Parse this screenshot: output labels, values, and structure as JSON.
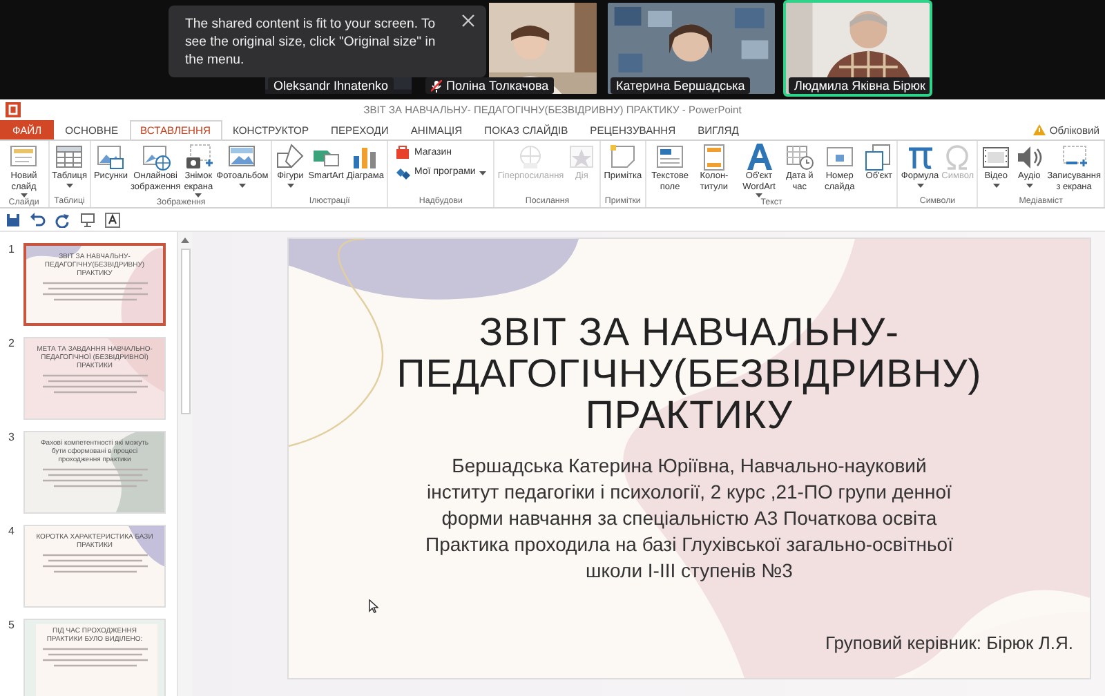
{
  "call": {
    "toast": {
      "text": "The shared content is fit to your screen. To see the original size, click \"Original size\" in the menu."
    },
    "participants": [
      {
        "name": "Oleksandr Ihnatenko",
        "muted": false,
        "speaking": false
      },
      {
        "name": "Поліна Толкачова",
        "muted": true,
        "speaking": false
      },
      {
        "name": "Катерина Бершадська",
        "muted": false,
        "speaking": false
      },
      {
        "name": "Людмила Яківна Бірюк",
        "muted": false,
        "speaking": true
      }
    ]
  },
  "powerpoint": {
    "title": "ЗВІТ ЗА НАВЧАЛЬНУ- ПЕДАГОГІЧНУ(БЕЗВІДРИВНУ) ПРАКТИКУ - PowerPoint",
    "tabs": [
      {
        "label": "ФАЙЛ",
        "kind": "file",
        "selected": false
      },
      {
        "label": "ОСНОВНЕ",
        "kind": "tab",
        "selected": false
      },
      {
        "label": "ВСТАВЛЕННЯ",
        "kind": "tab",
        "selected": true
      },
      {
        "label": "КОНСТРУКТОР",
        "kind": "tab",
        "selected": false
      },
      {
        "label": "ПЕРЕХОДИ",
        "kind": "tab",
        "selected": false
      },
      {
        "label": "АНІМАЦІЯ",
        "kind": "tab",
        "selected": false
      },
      {
        "label": "ПОКАЗ СЛАЙДІВ",
        "kind": "tab",
        "selected": false
      },
      {
        "label": "РЕЦЕНЗУВАННЯ",
        "kind": "tab",
        "selected": false
      },
      {
        "label": "ВИГЛЯД",
        "kind": "tab",
        "selected": false
      }
    ],
    "account": "Обліковий",
    "ribbon_groups": [
      {
        "label": "Слайди",
        "buttons": [
          {
            "kind": "large",
            "label": "Новий слайд",
            "dropdown": true,
            "disabled": false
          }
        ]
      },
      {
        "label": "Таблиці",
        "buttons": [
          {
            "kind": "large",
            "label": "Таблиця",
            "dropdown": true,
            "disabled": false
          }
        ]
      },
      {
        "label": "Зображення",
        "buttons": [
          {
            "kind": "large",
            "label": "Рисунки",
            "dropdown": false,
            "disabled": false
          },
          {
            "kind": "large",
            "label": "Онлайнові зображення",
            "dropdown": false,
            "disabled": false
          },
          {
            "kind": "large",
            "label": "Знімок екрана",
            "dropdown": true,
            "disabled": false
          },
          {
            "kind": "large",
            "label": "Фотоальбом",
            "dropdown": true,
            "disabled": false
          }
        ]
      },
      {
        "label": "Ілюстрації",
        "buttons": [
          {
            "kind": "large",
            "label": "Фігури",
            "dropdown": true,
            "disabled": false
          },
          {
            "kind": "large",
            "label": "SmartArt",
            "dropdown": false,
            "disabled": false
          },
          {
            "kind": "large",
            "label": "Діаграма",
            "dropdown": false,
            "disabled": false
          }
        ]
      },
      {
        "label": "Надбудови",
        "buttons": [
          {
            "kind": "small",
            "label": "Магазин",
            "dropdown": false,
            "disabled": false
          },
          {
            "kind": "small",
            "label": "Мої програми",
            "dropdown": true,
            "disabled": false
          }
        ]
      },
      {
        "label": "Посилання",
        "buttons": [
          {
            "kind": "large",
            "label": "Гіперпосилання",
            "dropdown": false,
            "disabled": true
          },
          {
            "kind": "large",
            "label": "Дія",
            "dropdown": false,
            "disabled": true
          }
        ]
      },
      {
        "label": "Примітки",
        "buttons": [
          {
            "kind": "large",
            "label": "Примітка",
            "dropdown": false,
            "disabled": false
          }
        ]
      },
      {
        "label": "Текст",
        "buttons": [
          {
            "kind": "large",
            "label": "Текстове поле",
            "dropdown": false,
            "disabled": false
          },
          {
            "kind": "large",
            "label": "Колон-титули",
            "dropdown": false,
            "disabled": false
          },
          {
            "kind": "large",
            "label": "Об'єкт WordArt",
            "dropdown": true,
            "disabled": false
          },
          {
            "kind": "large",
            "label": "Дата й час",
            "dropdown": false,
            "disabled": false
          },
          {
            "kind": "large",
            "label": "Номер слайда",
            "dropdown": false,
            "disabled": false
          },
          {
            "kind": "large",
            "label": "Об'єкт",
            "dropdown": false,
            "disabled": false
          }
        ]
      },
      {
        "label": "Символи",
        "buttons": [
          {
            "kind": "large",
            "label": "Формула",
            "dropdown": true,
            "disabled": false
          },
          {
            "kind": "large",
            "label": "Символ",
            "dropdown": false,
            "disabled": true
          }
        ]
      },
      {
        "label": "Медіавміст",
        "buttons": [
          {
            "kind": "large",
            "label": "Відео",
            "dropdown": true,
            "disabled": false
          },
          {
            "kind": "large",
            "label": "Аудіо",
            "dropdown": true,
            "disabled": false
          },
          {
            "kind": "large",
            "label": "Записування з екрана",
            "dropdown": false,
            "disabled": false
          }
        ]
      }
    ],
    "thumbnails": [
      {
        "number": "1",
        "title": "ЗВІТ ЗА НАВЧАЛЬНУ-ПЕДАГОГІЧНУ(БЕЗВІДРИВНУ) ПРАКТИКУ",
        "selected": true
      },
      {
        "number": "2",
        "title": "МЕТА ТА ЗАВДАННЯ НАВЧАЛЬНО-ПЕДАГОГІЧНОЇ (БЕЗВІДРИВНОЇ) ПРАКТИКИ",
        "selected": false
      },
      {
        "number": "3",
        "title": "Фахові компетентності які можуть бути сформовані в процесі проходження практики",
        "selected": false
      },
      {
        "number": "4",
        "title": "КОРОТКА ХАРАКТЕРИСТИКА БАЗИ ПРАКТИКИ",
        "selected": false
      },
      {
        "number": "5",
        "title": "ПІД ЧАС ПРОХОДЖЕННЯ ПРАКТИКИ БУЛО ВИДІЛЕНО:",
        "selected": false
      }
    ],
    "slide": {
      "title_lines": [
        "ЗВІТ ЗА НАВЧАЛЬНУ-",
        "ПЕДАГОГІЧНУ(БЕЗВІДРИВНУ)",
        "ПРАКТИКУ"
      ],
      "body_lines": [
        "Бершадська Катерина Юріївна, Навчально-науковий",
        "інститут педагогіки і психології, 2 курс ,21-ПО групи денної",
        "форми навчання за спеціальністю А3 Початкова освіта",
        "Практика проходила на базі Глухівської загально-освітньої",
        "школи І-ІІІ ступенів №3"
      ],
      "footer": "Груповий керівник: Бірюк Л.Я."
    }
  }
}
